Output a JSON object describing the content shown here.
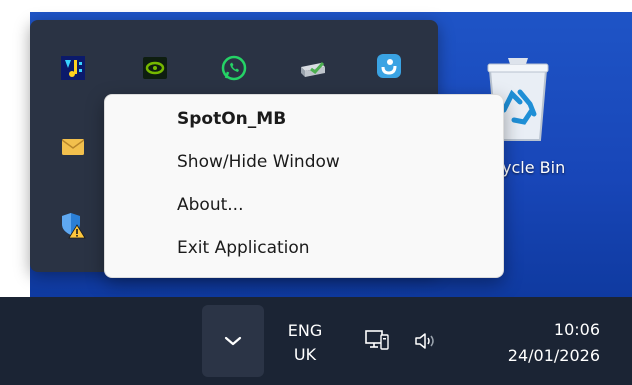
{
  "desktop": {
    "recycle_bin_label": "ycle Bin"
  },
  "tray_overflow": {
    "icons": [
      "spoton-icon",
      "nvidia-icon",
      "whatsapp-icon",
      "network-drive-icon",
      "app-blue-icon",
      "mail-icon",
      "security-warning-icon"
    ]
  },
  "context_menu": {
    "title": "SpotOn_MB",
    "items": [
      {
        "label": "Show/Hide Window"
      },
      {
        "label": "About..."
      },
      {
        "label": "Exit Application"
      }
    ]
  },
  "taskbar": {
    "lang_line1": "ENG",
    "lang_line2": "UK",
    "time": "10:06",
    "date": "24/01/2026"
  }
}
